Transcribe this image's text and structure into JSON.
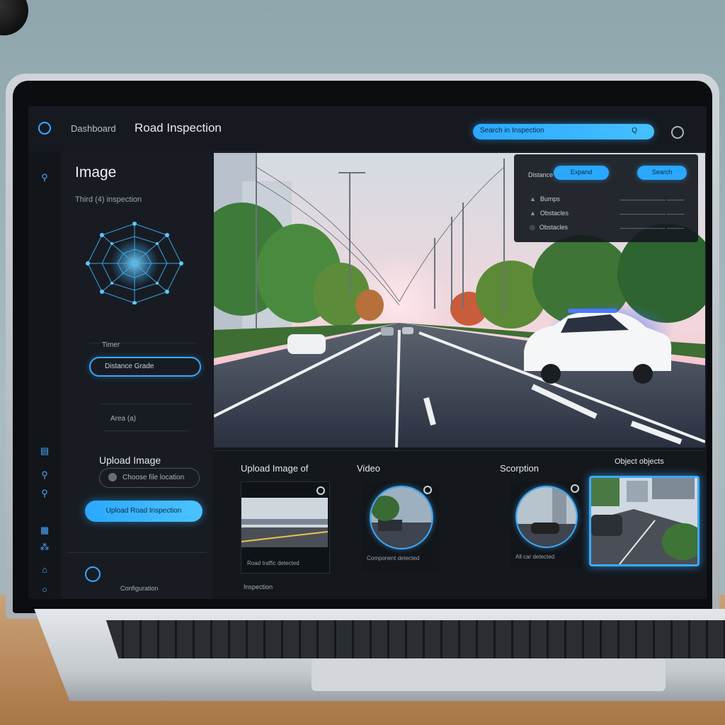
{
  "app": {
    "brand": "Dashboard",
    "title": "Road Inspection",
    "search_text": "Search in Inspection",
    "search_button": "Q"
  },
  "left_panel": {
    "title": "Image",
    "subtitle": "Third (4) inspection",
    "label1": "Timer",
    "pill_text": "Distance Grade",
    "label2": "Area (a)",
    "upload_label": "Upload Image",
    "file_field_text": "Choose file location",
    "upload_button": "Upload Road Inspection",
    "footer": "Configuration"
  },
  "overlay": {
    "label": "Distance",
    "button1": "Expand",
    "button2": "Search",
    "rows": [
      {
        "icon": "▲",
        "label": "Bumps",
        "value": "———————— ———"
      },
      {
        "icon": "▲",
        "label": "Obstacles",
        "value": "———————— ———"
      },
      {
        "icon": "◎",
        "label": "Obstacles",
        "value": "———————— ———"
      }
    ]
  },
  "strip": {
    "cards": [
      {
        "title": "Upload Image of",
        "caption": "Road traffic detected"
      },
      {
        "title": "Video",
        "caption": "Component detected"
      },
      {
        "title": "Scorption",
        "caption": "All car detected"
      },
      {
        "title": "Object objects",
        "caption": ""
      }
    ],
    "footer": "Inspection"
  },
  "colors": {
    "accent": "#2aa8ff",
    "panel": "#181c22",
    "background": "#15191f"
  },
  "icons": [
    "clock-icon",
    "search-icon",
    "book-icon",
    "search-icon-2",
    "search-icon-3",
    "grid-icon",
    "people-icon",
    "bell-icon",
    "circle-icon",
    "profile-icon",
    "timer-icon"
  ]
}
